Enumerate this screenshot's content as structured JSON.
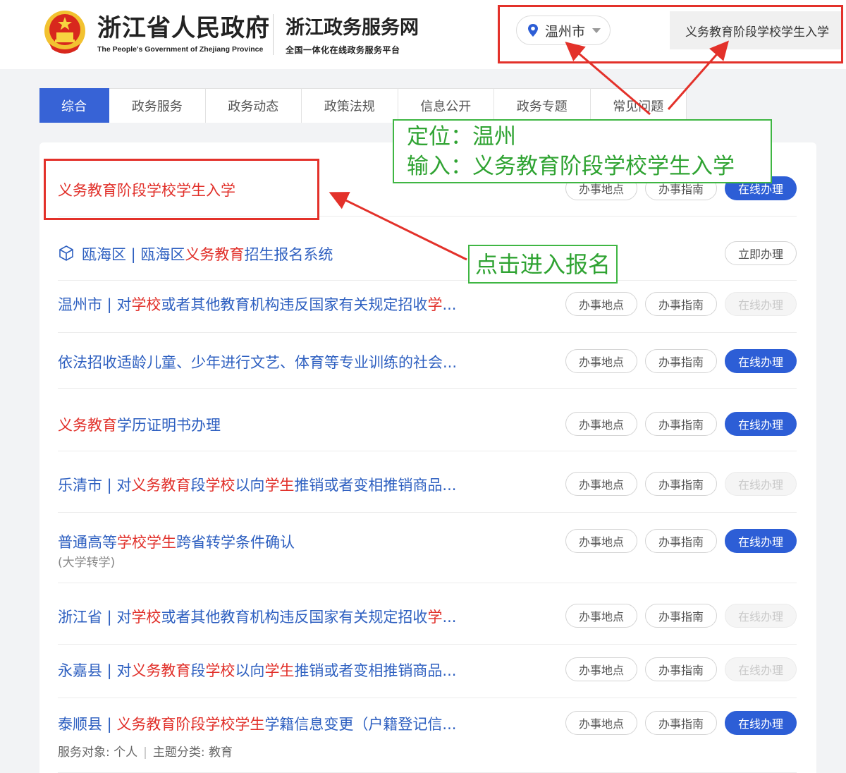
{
  "header": {
    "gov_title": "浙江省人民政府",
    "gov_subtitle": "The People's Government of Zhejiang Province",
    "portal_title": "浙江政务服务网",
    "portal_subtitle": "全国一体化在线政务服务平台",
    "location": "温州市",
    "search_value": "义务教育阶段学校学生入学"
  },
  "tabs": [
    {
      "label": "综合",
      "active": true
    },
    {
      "label": "政务服务"
    },
    {
      "label": "政务动态"
    },
    {
      "label": "政策法规"
    },
    {
      "label": "信息公开"
    },
    {
      "label": "政务专题"
    },
    {
      "label": "常见问题"
    }
  ],
  "buttons": {
    "place": "办事地点",
    "guide": "办事指南",
    "online": "在线办理",
    "now": "立即办理"
  },
  "results": [
    {
      "title": "义务教育阶段学校学生入学"
    },
    {
      "region": "瓯海区",
      "sep": " | ",
      "pre": "瓯海区",
      "hl": "义务教育",
      "post": "招生报名系统"
    },
    {
      "region": "温州市",
      "sep": " | ",
      "t1": "对",
      "h1": "学校",
      "t2": "或者其他教育机构违反国家有关规定招收",
      "h2": "学",
      "t3": "..."
    },
    {
      "title": "依法招收适龄儿童、少年进行文艺、体育等专业训练的社会..."
    },
    {
      "h1": "义务教育",
      "t1": "学历证明书办理"
    },
    {
      "region": "乐清市",
      "sep": " | ",
      "t1": "对",
      "h1": "义务教育",
      "t2": "段",
      "h2": "学校",
      "t3": "以向",
      "h3": "学生",
      "t4": "推销或者变相推销商品..."
    },
    {
      "t1": "普通高等",
      "h1": "学校学生",
      "t2": "跨省转学条件确认",
      "sub": "(大学转学)"
    },
    {
      "region": "浙江省",
      "sep": " | ",
      "t1": "对",
      "h1": "学校",
      "t2": "或者其他教育机构违反国家有关规定招收",
      "h2": "学",
      "t3": "..."
    },
    {
      "region": "永嘉县",
      "sep": " | ",
      "t1": "对",
      "h1": "义务教育",
      "t2": "段",
      "h2": "学校",
      "t3": "以向",
      "h3": "学生",
      "t4": "推销或者变相推销商品..."
    },
    {
      "region": "泰顺县",
      "sep": " | ",
      "h1": "义务教育阶段学校学生",
      "t1": "学籍信息变更（户籍登记信...",
      "meta_target_label": "服务对象:",
      "meta_target": "个人",
      "meta_cat_label": "主题分类:",
      "meta_cat": "教育"
    }
  ],
  "annotations": {
    "note1_line1": "定位：温州",
    "note1_line2": "输入：义务教育阶段学校学生入学",
    "note2": "点击进入报名"
  },
  "colors": {
    "accent": "#3763d6",
    "link": "#2d5fc0",
    "highlight": "#e1302a",
    "annotation_red": "#e3312a",
    "annotation_green": "#3fb643"
  },
  "icons": [
    "national-emblem-icon",
    "location-pin-icon",
    "chevron-down-icon",
    "cube-icon"
  ]
}
